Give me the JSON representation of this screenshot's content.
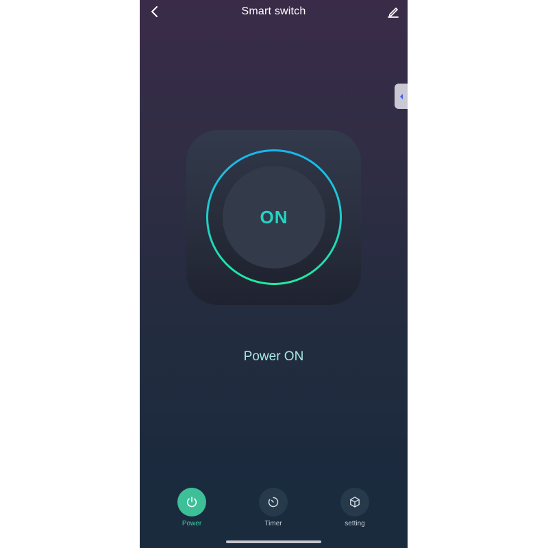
{
  "header": {
    "title": "Smart switch"
  },
  "switch": {
    "state_label": "ON",
    "status_text": "Power ON"
  },
  "nav": {
    "items": [
      {
        "label": "Power",
        "icon": "power-icon",
        "active": true
      },
      {
        "label": "Timer",
        "icon": "timer-icon",
        "active": false
      },
      {
        "label": "setting",
        "icon": "cube-icon",
        "active": false
      }
    ]
  },
  "colors": {
    "accent": "#22d4c4",
    "active_nav": "#3dbf97",
    "ring_top": "#1ab4f0",
    "ring_bottom": "#20eaa0"
  }
}
